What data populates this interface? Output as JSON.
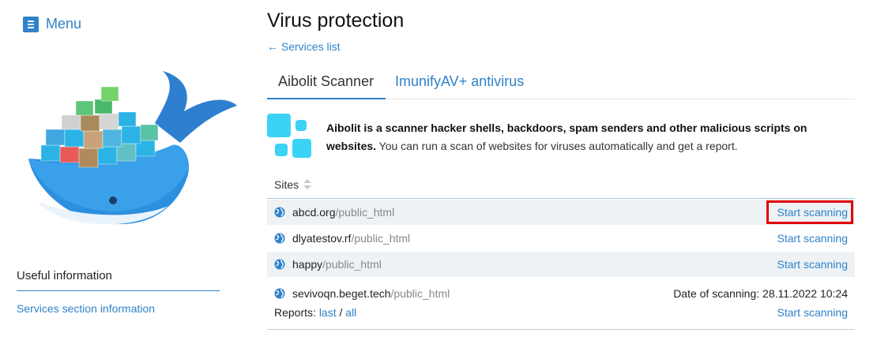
{
  "sidebar": {
    "menu_label": "Menu",
    "useful_title": "Useful information",
    "useful_link": "Services section information"
  },
  "main": {
    "title": "Virus protection",
    "back_link": "← Services list",
    "tabs": [
      {
        "label": "Aibolit Scanner",
        "active": true
      },
      {
        "label": "ImunifyAV+ antivirus",
        "active": false
      }
    ],
    "info": {
      "bold": "Aibolit is a scanner hacker shells, backdoors, spam senders and other malicious scripts on websites.",
      "rest": " You can run a scan of websites for viruses automatically and get a report."
    },
    "sites_header": "Sites",
    "rows": [
      {
        "domain": "abcd.org",
        "path": "/public_html",
        "action": "Start scanning"
      },
      {
        "domain": "dlyatestov.rf",
        "path": "/public_html",
        "action": "Start scanning"
      },
      {
        "domain": "happy",
        "path": "/public_html",
        "action": "Start scanning"
      },
      {
        "domain": "sevivoqn.beget.tech",
        "path": "/public_html",
        "date": "Date of scanning: 28.11.2022 10:24",
        "reports_label": "Reports: ",
        "reports_last": "last",
        "reports_sep": " / ",
        "reports_all": "all",
        "action": "Start scanning"
      }
    ]
  },
  "colors": {
    "accent": "#2f82c9",
    "row_shade": "#eef2f5",
    "highlight": "#e00000",
    "logo_cyan": "#3ad3f5"
  }
}
